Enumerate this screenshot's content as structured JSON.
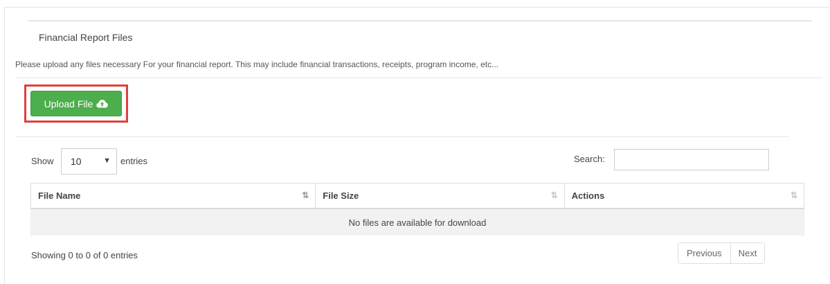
{
  "section": {
    "title": "Financial Report Files",
    "description": "Please upload any files necessary For your financial report. This may include financial transactions, receipts, program income, etc..."
  },
  "upload": {
    "label": "Upload File",
    "icon": "cloud-upload-icon"
  },
  "length_menu": {
    "show_label": "Show",
    "selected": "10",
    "entries_label": "entries"
  },
  "search": {
    "label": "Search:",
    "value": ""
  },
  "table": {
    "columns": [
      "File Name",
      "File Size",
      "Actions"
    ],
    "empty_message": "No files are available for download"
  },
  "footer": {
    "info": "Showing 0 to 0 of 0 entries",
    "previous_label": "Previous",
    "next_label": "Next"
  },
  "colors": {
    "accent_green": "#4cae4c",
    "highlight_red": "#e0403c"
  }
}
